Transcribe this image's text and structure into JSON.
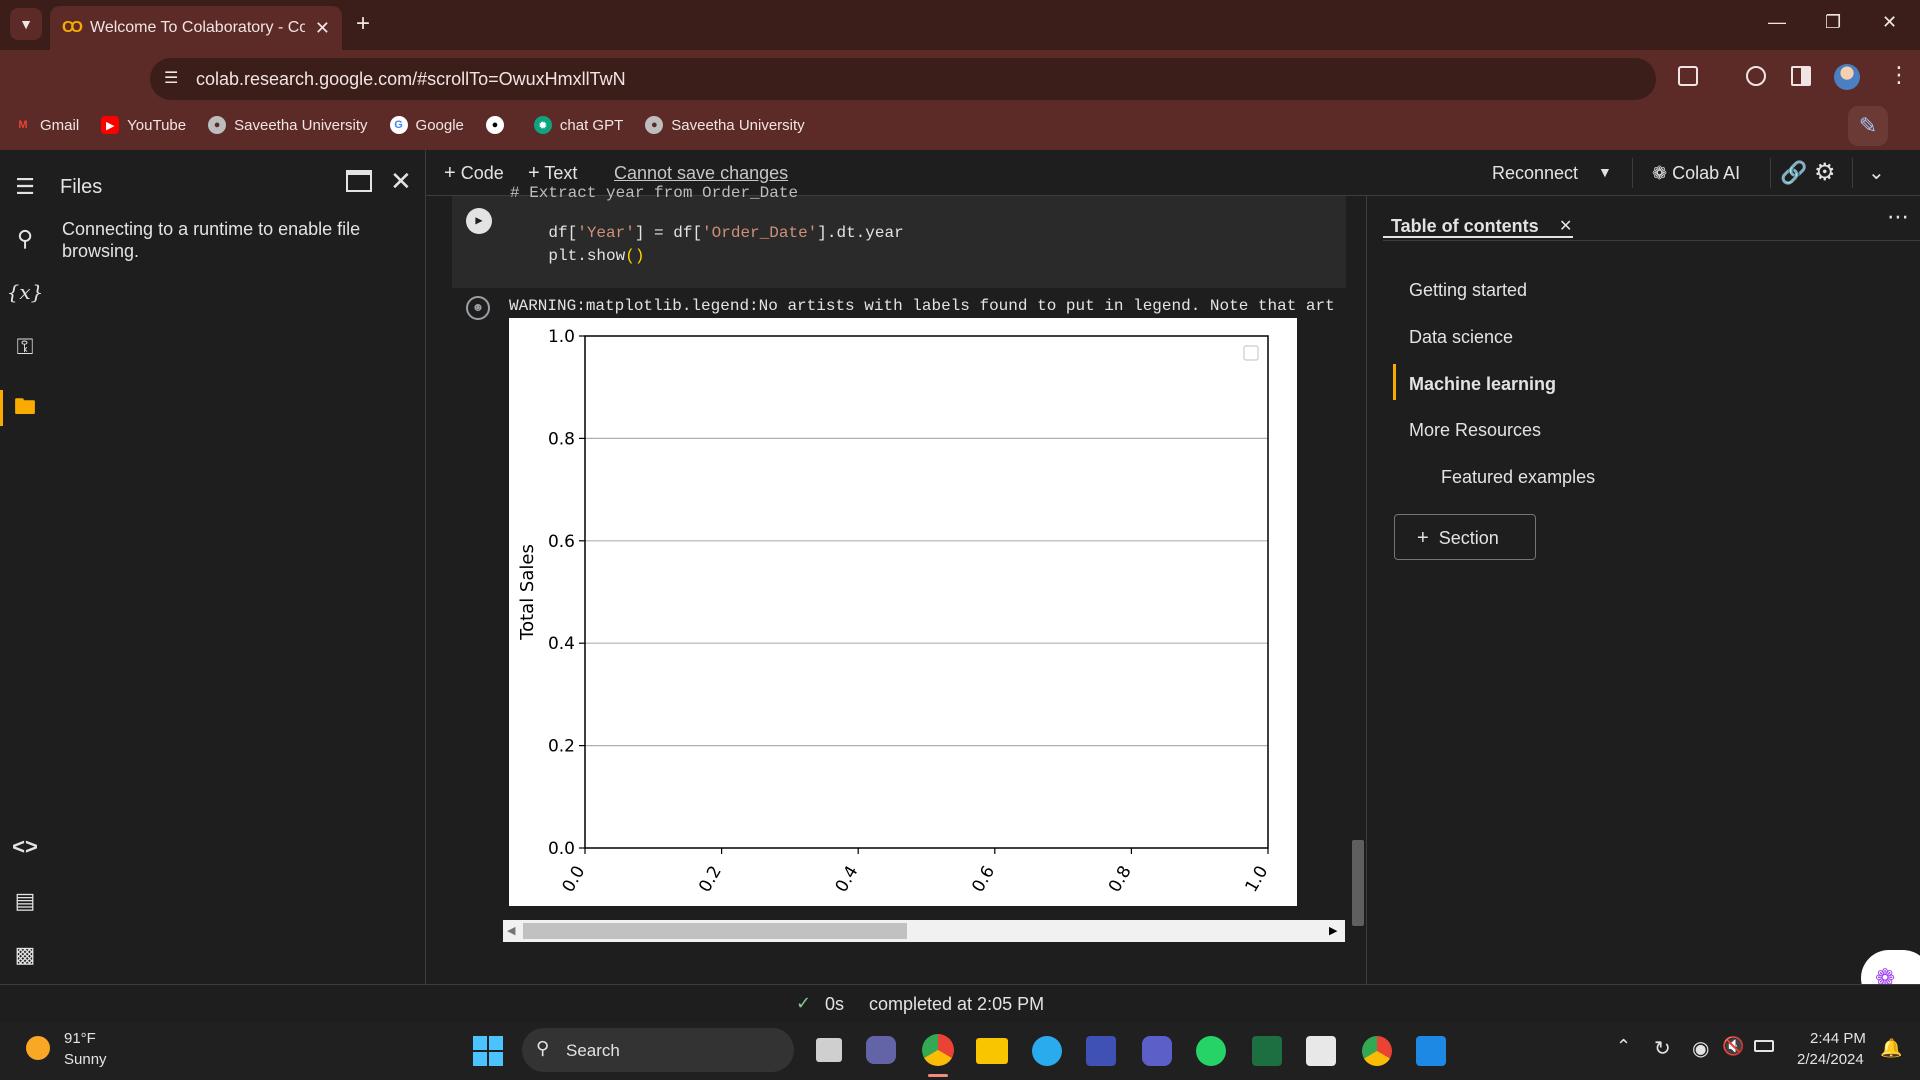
{
  "browser": {
    "tab_title": "Welcome To Colaboratory - Col",
    "url": "colab.research.google.com/#scrollTo=OwuxHmxllTwN",
    "bookmarks": [
      {
        "label": "Gmail",
        "icon": "gmail-icon",
        "color": "#ea4335"
      },
      {
        "label": "YouTube",
        "icon": "youtube-icon",
        "color": "#ff0000"
      },
      {
        "label": "Saveetha University",
        "icon": "globe-icon",
        "color": "#bdbdbd"
      },
      {
        "label": "Google",
        "icon": "google-icon",
        "color": "#4285f4"
      },
      {
        "label": "",
        "icon": "github-icon",
        "color": "#ffffff"
      },
      {
        "label": "chat GPT",
        "icon": "chatgpt-icon",
        "color": "#10a37f"
      },
      {
        "label": "Saveetha University",
        "icon": "globe-icon",
        "color": "#bdbdbd"
      }
    ]
  },
  "colab": {
    "files_title": "Files",
    "files_message": "Connecting to a runtime to enable file browsing.",
    "toolbar": {
      "add_code": "Code",
      "add_text": "Text",
      "cannot_save": "Cannot save changes",
      "reconnect": "Reconnect",
      "colab_ai": "Colab AI"
    },
    "cell": {
      "hidden_comment": "# Extract year from Order_Date",
      "line1": [
        "df[",
        "'Year'",
        "] = df[",
        "'Order_Date'",
        "].dt.year"
      ],
      "line2": [
        "plt.show",
        "()"
      ],
      "output_warning": "WARNING:matplotlib.legend:No artists with labels found to put in legend.  Note that art"
    },
    "toc": {
      "title": "Table of contents",
      "items": [
        {
          "label": "Getting started",
          "active": false,
          "indent": false
        },
        {
          "label": "Data science",
          "active": false,
          "indent": false
        },
        {
          "label": "Machine learning",
          "active": true,
          "indent": false
        },
        {
          "label": "More Resources",
          "active": false,
          "indent": false
        },
        {
          "label": "Featured examples",
          "active": false,
          "indent": true
        }
      ],
      "section_button": "Section"
    },
    "status": {
      "duration": "0s",
      "completed": "completed at 2:05 PM"
    }
  },
  "chart_data": {
    "type": "line",
    "title": "",
    "xlabel": "",
    "ylabel": "Total Sales",
    "xlim": [
      0.0,
      1.0
    ],
    "ylim": [
      0.0,
      1.0
    ],
    "xticks": [
      "0.0",
      "0.2",
      "0.4",
      "0.6",
      "0.8",
      "1.0"
    ],
    "yticks": [
      "0.0",
      "0.2",
      "0.4",
      "0.6",
      "0.8",
      "1.0"
    ],
    "grid": "horizontal",
    "legend": "upper right (empty)",
    "series": []
  },
  "taskbar": {
    "weather_temp": "91°F",
    "weather_desc": "Sunny",
    "search": "Search",
    "time": "2:44 PM",
    "date": "2/24/2024"
  }
}
